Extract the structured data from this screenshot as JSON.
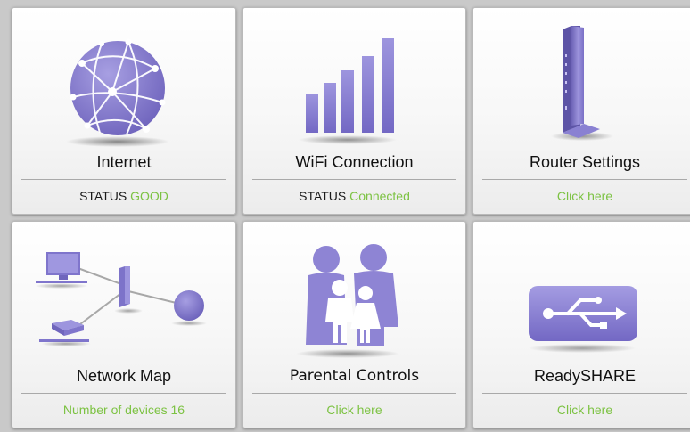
{
  "tiles": [
    {
      "id": "internet",
      "title": "Internet",
      "status_prefix": "STATUS",
      "status_value": "GOOD",
      "icon": "globe-icon"
    },
    {
      "id": "wifi",
      "title": "WiFi Connection",
      "status_prefix": "STATUS",
      "status_value": "Connected",
      "icon": "signal-bars-icon"
    },
    {
      "id": "router",
      "title": "Router Settings",
      "status_value": "Click here",
      "icon": "router-icon"
    },
    {
      "id": "network-map",
      "title": "Network Map",
      "status_value": "Number of devices 16",
      "icon": "network-map-icon"
    },
    {
      "id": "parental",
      "title": "Parental Controls",
      "status_value": "Click here",
      "icon": "family-icon"
    },
    {
      "id": "readyshare",
      "title": "ReadySHARE",
      "status_value": "Click here",
      "icon": "usb-icon"
    }
  ],
  "colors": {
    "icon": "#8e84d4",
    "icon_dark": "#6e63b8",
    "status_green": "#7cc242",
    "text": "#111111",
    "background": "#c9c9c9"
  }
}
